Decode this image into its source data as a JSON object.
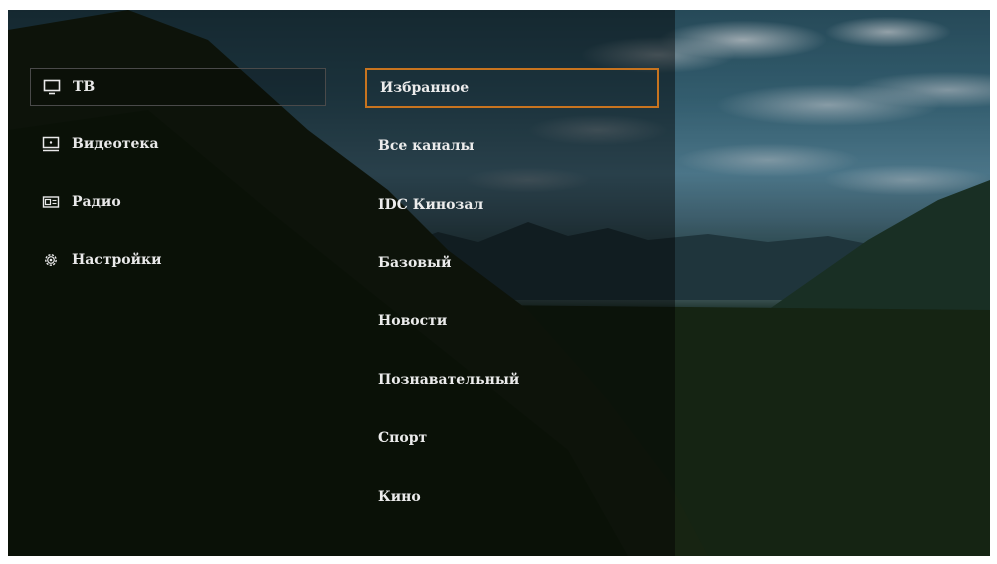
{
  "theme": {
    "focus_border": "#c8741f",
    "text": "#ececec",
    "selected_border": "#4a4a4a"
  },
  "nav": {
    "items": [
      {
        "label": "ТВ",
        "icon": "tv-icon",
        "selected": true
      },
      {
        "label": "Видеотека",
        "icon": "video-library-icon",
        "selected": false
      },
      {
        "label": "Радио",
        "icon": "radio-icon",
        "selected": false
      },
      {
        "label": "Настройки",
        "icon": "gear-icon",
        "selected": false
      }
    ]
  },
  "categories": {
    "items": [
      {
        "label": "Избранное",
        "focused": true
      },
      {
        "label": "Все каналы",
        "focused": false
      },
      {
        "label": "IDC Кинозал",
        "focused": false
      },
      {
        "label": "Базовый",
        "focused": false
      },
      {
        "label": "Новости",
        "focused": false
      },
      {
        "label": "Познавательный",
        "focused": false
      },
      {
        "label": "Спорт",
        "focused": false
      },
      {
        "label": "Кино",
        "focused": false
      }
    ]
  }
}
